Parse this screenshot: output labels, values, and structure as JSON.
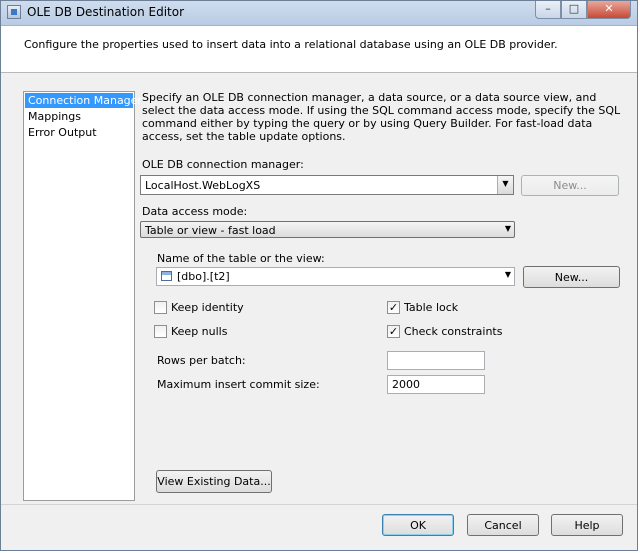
{
  "window": {
    "title": "OLE DB Destination Editor"
  },
  "header": {
    "text": "Configure the properties used to insert data into a relational database using an OLE DB provider."
  },
  "nav": {
    "items": [
      {
        "label": "Connection Manager",
        "selected": true
      },
      {
        "label": "Mappings",
        "selected": false
      },
      {
        "label": "Error Output",
        "selected": false
      }
    ]
  },
  "main": {
    "description": "Specify an OLE DB connection manager, a data source, or a data source view, and select the data access mode. If using the SQL command access mode, specify the SQL command either by typing the query or by using Query Builder. For fast-load data access, set the table update options.",
    "connection_label": "OLE DB connection manager:",
    "connection_value": "LocalHost.WebLogXS",
    "new_connection_button": "New...",
    "access_mode_label": "Data access mode:",
    "access_mode_value": "Table or view - fast load",
    "table_label": "Name of the table or the view:",
    "table_value": "[dbo].[t2]",
    "new_table_button": "New...",
    "keep_identity": {
      "label": "Keep identity",
      "checked": false
    },
    "table_lock": {
      "label": "Table lock",
      "checked": true
    },
    "keep_nulls": {
      "label": "Keep nulls",
      "checked": false
    },
    "check_constraints": {
      "label": "Check constraints",
      "checked": true
    },
    "rows_per_batch_label": "Rows per batch:",
    "rows_per_batch_value": "",
    "max_commit_label": "Maximum insert commit size:",
    "max_commit_value": "2000",
    "view_data_button": "View Existing Data..."
  },
  "footer": {
    "ok": "OK",
    "cancel": "Cancel",
    "help": "Help"
  },
  "icons": {
    "check": "✓",
    "dropdown": "▼"
  }
}
